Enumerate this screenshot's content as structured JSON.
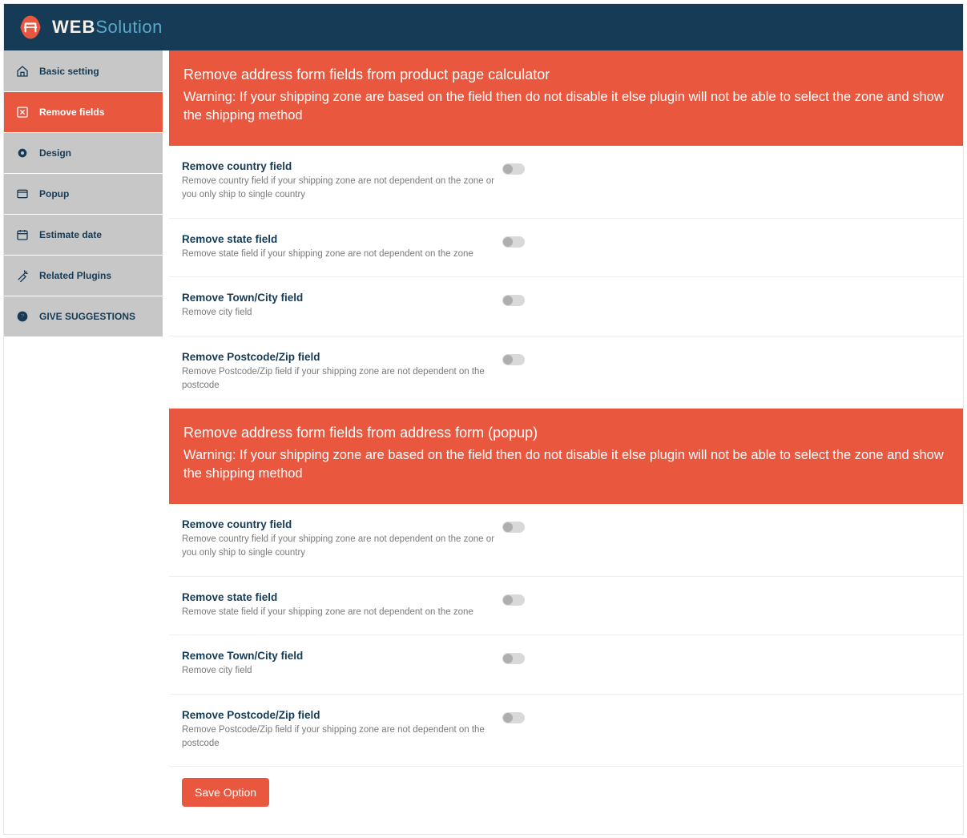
{
  "logo": {
    "web": "WEB",
    "solution": "Solution"
  },
  "sidebar": {
    "items": [
      {
        "label": "Basic setting"
      },
      {
        "label": "Remove fields"
      },
      {
        "label": "Design"
      },
      {
        "label": "Popup"
      },
      {
        "label": "Estimate date"
      },
      {
        "label": "Related Plugins"
      },
      {
        "label": "GIVE SUGGESTIONS"
      }
    ]
  },
  "section1": {
    "title": "Remove address form fields from product page calculator",
    "warning": "Warning: If your shipping zone are based on the field then do not disable it else plugin will not be able to select the zone and show the shipping method",
    "rows": [
      {
        "title": "Remove country field",
        "desc": "Remove country field if your shipping zone are not dependent on the zone or you only ship to single country"
      },
      {
        "title": "Remove state field",
        "desc": "Remove state field if your shipping zone are not dependent on the zone"
      },
      {
        "title": "Remove Town/City field",
        "desc": "Remove city field"
      },
      {
        "title": "Remove Postcode/Zip field",
        "desc": "Remove Postcode/Zip field if your shipping zone are not dependent on the postcode"
      }
    ]
  },
  "section2": {
    "title": "Remove address form fields from address form (popup)",
    "warning": "Warning: If your shipping zone are based on the field then do not disable it else plugin will not be able to select the zone and show the shipping method",
    "rows": [
      {
        "title": "Remove country field",
        "desc": "Remove country field if your shipping zone are not dependent on the zone or you only ship to single country"
      },
      {
        "title": "Remove state field",
        "desc": "Remove state field if your shipping zone are not dependent on the zone"
      },
      {
        "title": "Remove Town/City field",
        "desc": "Remove city field"
      },
      {
        "title": "Remove Postcode/Zip field",
        "desc": "Remove Postcode/Zip field if your shipping zone are not dependent on the postcode"
      }
    ]
  },
  "save": {
    "label": "Save Option"
  }
}
